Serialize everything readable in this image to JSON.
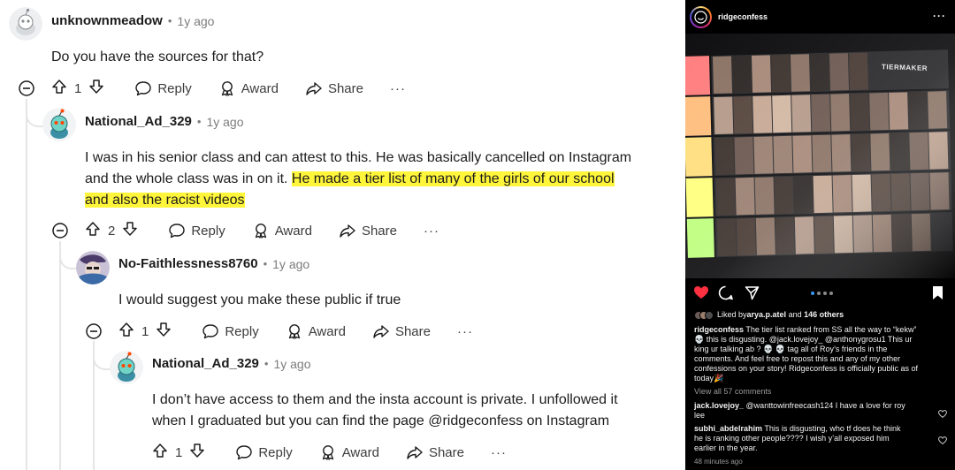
{
  "reddit": {
    "comments": [
      {
        "author": "unknownmeadow",
        "time": "1y ago",
        "text": "Do you have the sources for that?",
        "votes": "1",
        "reply": "Reply",
        "award": "Award",
        "share": "Share",
        "more": "···"
      },
      {
        "author": "National_Ad_329",
        "time": "1y ago",
        "text_line1": "I was in his senior class and can attest to this. He was basically cancelled on Instagram",
        "text_line2_plain": "and the whole class was in on it. ",
        "text_line2_highlight": "He made a tier list of many of the girls of our school",
        "text_line3_highlight": "and also the racist videos",
        "votes": "2",
        "reply": "Reply",
        "award": "Award",
        "share": "Share",
        "more": "···"
      },
      {
        "author": "No-Faithlessness8760",
        "time": "1y ago",
        "text": "I would suggest you make these public if true",
        "votes": "1",
        "reply": "Reply",
        "award": "Award",
        "share": "Share",
        "more": "···"
      },
      {
        "author": "National_Ad_329",
        "time": "1y ago",
        "text_line1": "I don’t have access to them and the insta account is private. I unfollowed it",
        "text_line2": "when I graduated but you can find the page @ridgeconfess on Instagram",
        "votes": "1",
        "reply": "Reply",
        "award": "Award",
        "share": "Share",
        "more": "···"
      }
    ],
    "highlight_color": "#fff53a"
  },
  "instagram": {
    "username": "ridgeconfess",
    "more": "···",
    "photo_logo": "TIERMAKER",
    "liked_by_prefix": "Liked by ",
    "liked_by_user": "arya.p.atel",
    "liked_by_mid": " and ",
    "liked_by_count": "146 others",
    "caption_user": "ridgeconfess",
    "caption_lines": [
      " The tier list ranked from SS all the way to “kekw”",
      "💀 this is disgusting. @jack.lovejoy_ @anthonygrosu1 This ur",
      "king ur talking ab ? 💀 💀 tag all of Roy’s friends in the",
      "comments. And feel free to repost this and any of my other",
      "confessions on your story! Ridgeconfess is officially public as of",
      "today🎉"
    ],
    "view_comments": "View all 57 comments",
    "comments": [
      {
        "user": "jack.lovejoy_",
        "lines": [
          " @wanttowinfreecash124 I have a love for roy",
          "lee"
        ]
      },
      {
        "user": "subhi_abdelrahim",
        "lines": [
          " This is disgusting, who tf does he think",
          "he is ranking other people???? I wish y’all exposed him",
          "earlier in the year."
        ]
      }
    ],
    "posted": "48 minutes ago",
    "tier_colors": [
      "#ff7f7f",
      "#ffbf7f",
      "#ffdf7f",
      "#ffff7f",
      "#bfff7f"
    ]
  }
}
